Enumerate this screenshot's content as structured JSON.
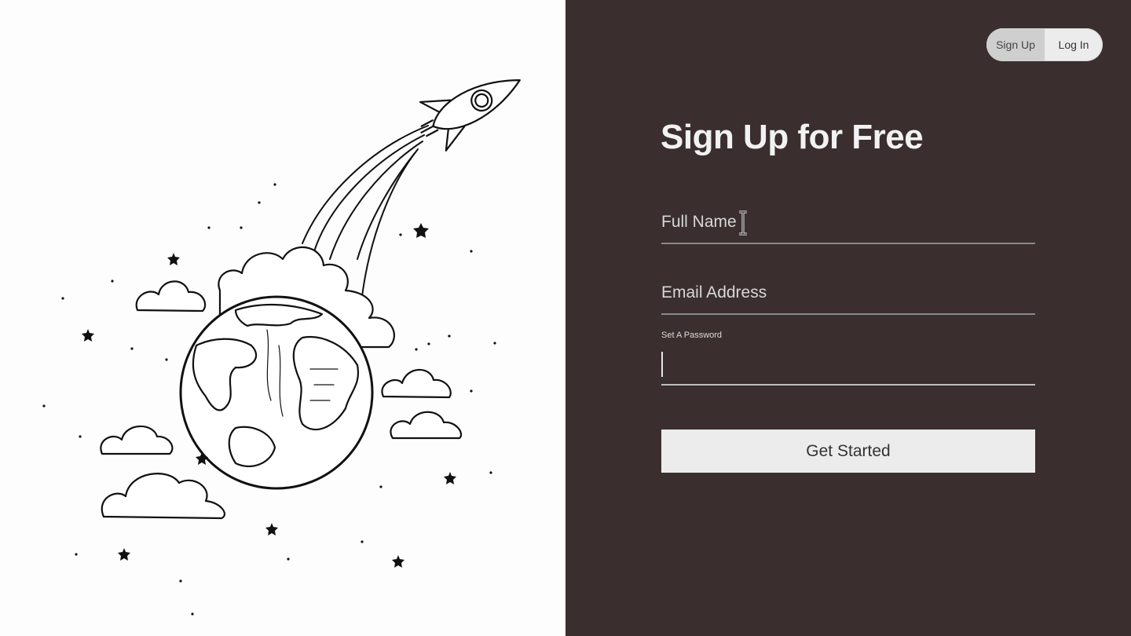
{
  "auth_toggle": {
    "signup_label": "Sign Up",
    "login_label": "Log In",
    "active": "signup"
  },
  "form": {
    "title": "Sign Up for Free",
    "full_name_placeholder": "Full Name",
    "email_placeholder": "Email Address",
    "password_label": "Set A Password",
    "submit_label": "Get Started"
  },
  "colors": {
    "panel_bg": "#3a2e2e",
    "illustration_bg": "#fdfdfd",
    "button_bg": "#ececec"
  },
  "illustration": {
    "subject": "rocket launching from earth with clouds and stars"
  }
}
